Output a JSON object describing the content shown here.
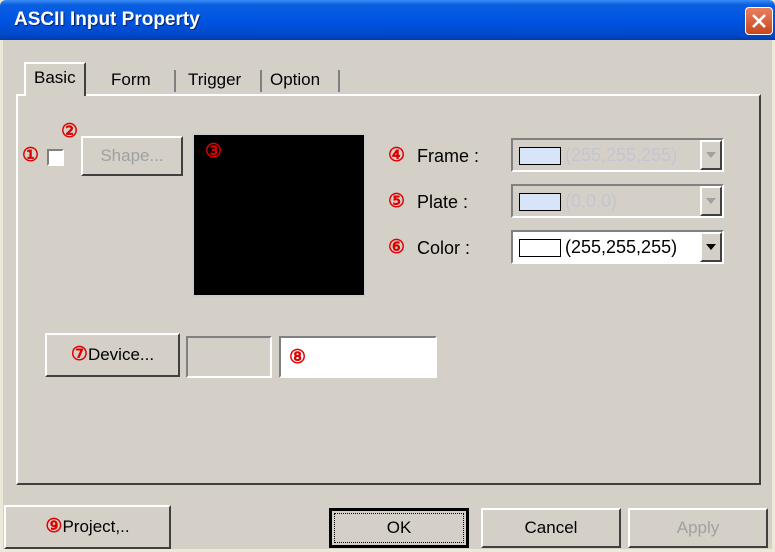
{
  "window": {
    "title": "ASCII Input Property"
  },
  "tabs": [
    {
      "label": "Basic",
      "selected": true
    },
    {
      "label": "Form"
    },
    {
      "label": "Trigger"
    },
    {
      "label": "Option"
    }
  ],
  "markers": [
    "①",
    "②",
    "③",
    "④",
    "⑤",
    "⑥",
    "⑦",
    "⑧",
    "⑨"
  ],
  "basic": {
    "shape_button": "Shape...",
    "shape_checked": false,
    "frame": {
      "label": "Frame :",
      "value": "(255,255,255)",
      "swatch": "#d8e4f8",
      "enabled": false
    },
    "plate": {
      "label": "Plate :",
      "value": "(0,0,0)",
      "swatch": "#d8e4f8",
      "enabled": false
    },
    "color": {
      "label": "Color :",
      "value": "(255,255,255)",
      "swatch": "#ffffff",
      "enabled": true
    },
    "preview_color": "#000000",
    "device_button": "Device...",
    "device_value": "",
    "address_value": ""
  },
  "footer": {
    "project_button": "Project,..",
    "ok_button": "OK",
    "cancel_button": "Cancel",
    "apply_button": "Apply"
  },
  "colors": {
    "titlebar": "#0054e3",
    "marker": "#e00000",
    "dialog": "#d4d0c8"
  }
}
